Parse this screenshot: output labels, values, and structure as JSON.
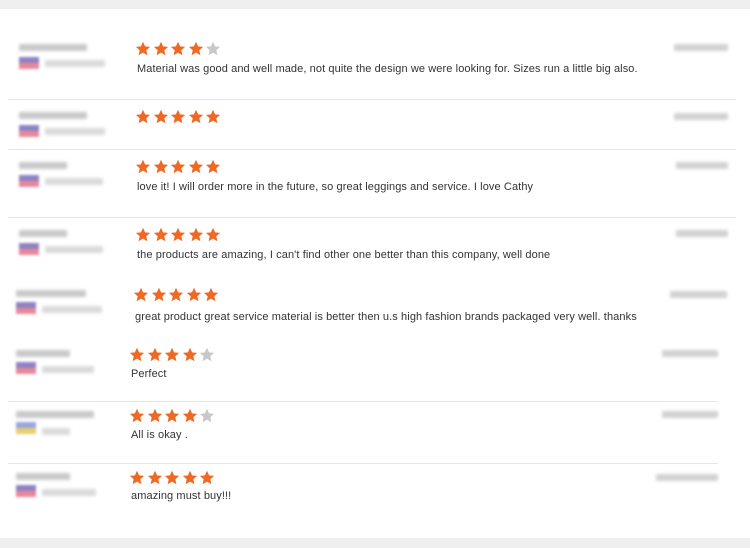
{
  "colors": {
    "star_filled": "#ee6a24",
    "star_empty": "#c8c8c8",
    "divider": "#e6e6e6"
  },
  "reviews": [
    {
      "rating": 4,
      "text": "Material was good and well made, not quite the design we were looking for. Sizes run a little big also.",
      "flag": "default"
    },
    {
      "rating": 5,
      "text": "",
      "flag": "default"
    },
    {
      "rating": 5,
      "text": "love it! I will order more in the future, so great leggings and service. I love Cathy",
      "flag": "default"
    },
    {
      "rating": 5,
      "text": "the products are amazing, I can't find other one better than this company, well done",
      "flag": "default"
    },
    {
      "rating": 5,
      "text": "great product great service material is better then u.s high fashion brands packaged very well. thanks",
      "flag": "default"
    },
    {
      "rating": 4,
      "text": "Perfect",
      "flag": "default"
    },
    {
      "rating": 4,
      "text": "All is okay .",
      "flag": "yellow"
    },
    {
      "rating": 5,
      "text": "amazing must buy!!!",
      "flag": "default"
    }
  ],
  "star_max": 5,
  "icons": {
    "star": "star-icon",
    "flag": "country-flag-icon"
  }
}
